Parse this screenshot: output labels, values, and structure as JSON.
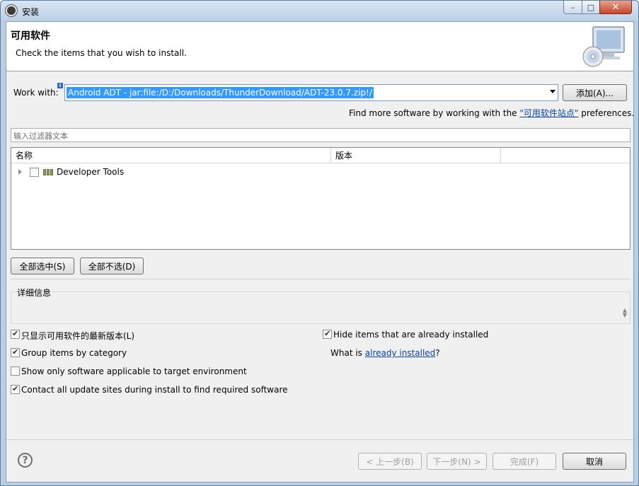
{
  "window": {
    "title": "安装"
  },
  "banner": {
    "title": "可用软件",
    "description": "Check the items that you wish to install."
  },
  "work_with": {
    "label": "Work with:",
    "value": "Android ADT - jar:file:/D:/Downloads/ThunderDownload/ADT-23.0.7.zip!/",
    "add_label": "添加(A)..."
  },
  "find_more": {
    "prefix": "Find more software by working with the ",
    "link": "\"可用软件站点\"",
    "suffix": " preferences."
  },
  "filter": {
    "placeholder": "输入过滤器文本"
  },
  "tree": {
    "columns": [
      "名称",
      "版本"
    ],
    "rows": [
      {
        "label": "Developer Tools",
        "checked": false
      }
    ]
  },
  "buttons": {
    "select_all": "全部选中(S)",
    "deselect_all": "全部不选(D)",
    "back": "< 上一步(B)",
    "next": "下一步(N) >",
    "finish": "完成(F)",
    "cancel": "取消"
  },
  "details": {
    "label": "详细信息"
  },
  "options": {
    "latest_only": {
      "label": "只显示可用软件的最新版本(L)",
      "checked": true
    },
    "group_by_category": {
      "label": "Group items by category",
      "checked": true
    },
    "applicable_only": {
      "label": "Show only software applicable to target environment",
      "checked": false
    },
    "contact_sites": {
      "label": "Contact all update sites during install to find required software",
      "checked": true
    },
    "hide_installed": {
      "label": "Hide items that are already installed",
      "checked": true
    }
  },
  "what_is": {
    "prefix": "What is ",
    "link": "already installed",
    "suffix": "?"
  }
}
